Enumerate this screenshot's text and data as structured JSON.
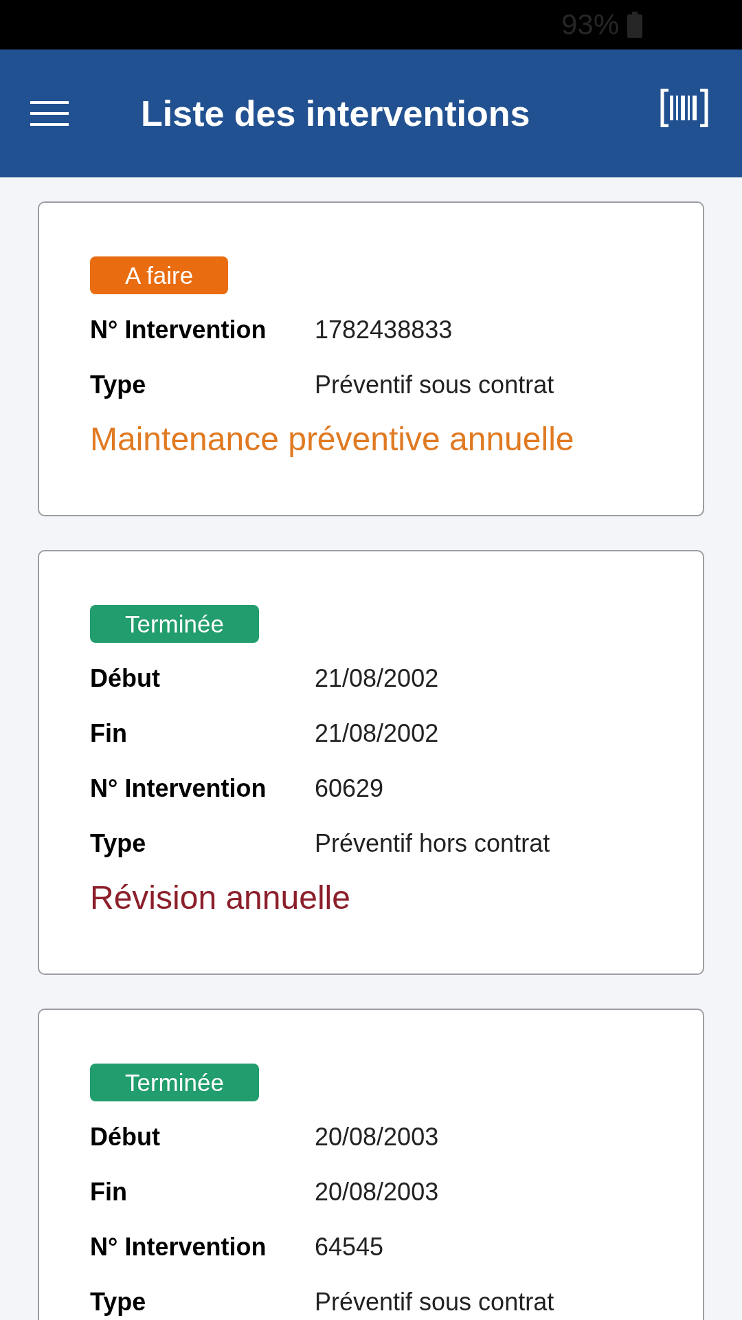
{
  "status_bar": {
    "battery": "93%"
  },
  "app_bar": {
    "title": "Liste des interventions"
  },
  "interventions": [
    {
      "status": {
        "label": "A faire",
        "color": "#e96c10"
      },
      "fields": [
        {
          "label": "N° Intervention",
          "value": "1782438833"
        },
        {
          "label": "Type",
          "value": "Préventif sous contrat"
        }
      ],
      "title": {
        "text": "Maintenance préventive annuelle",
        "color": "#e07a22"
      }
    },
    {
      "status": {
        "label": "Terminée",
        "color": "#229d6d"
      },
      "fields": [
        {
          "label": "Début",
          "value": "21/08/2002"
        },
        {
          "label": "Fin",
          "value": "21/08/2002"
        },
        {
          "label": "N° Intervention",
          "value": "60629"
        },
        {
          "label": "Type",
          "value": "Préventif hors contrat"
        }
      ],
      "title": {
        "text": "Révision annuelle",
        "color": "#8c1f2b"
      }
    },
    {
      "status": {
        "label": "Terminée",
        "color": "#229d6d"
      },
      "fields": [
        {
          "label": "Début",
          "value": "20/08/2003"
        },
        {
          "label": "Fin",
          "value": "20/08/2003"
        },
        {
          "label": "N° Intervention",
          "value": "64545"
        },
        {
          "label": "Type",
          "value": "Préventif sous contrat"
        }
      ]
    }
  ]
}
